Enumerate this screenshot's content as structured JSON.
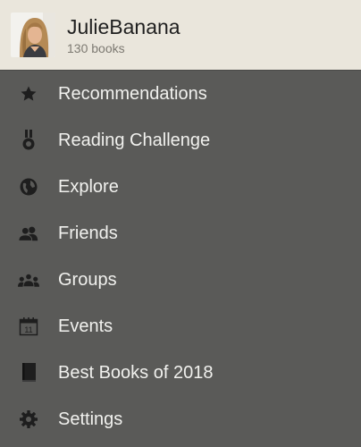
{
  "profile": {
    "username": "JulieBanana",
    "book_count": "130 books",
    "avatar_icon": "user-avatar-photo"
  },
  "menu": {
    "items": [
      {
        "label": "Recommendations",
        "icon": "star-icon"
      },
      {
        "label": "Reading Challenge",
        "icon": "medal-icon"
      },
      {
        "label": "Explore",
        "icon": "globe-icon"
      },
      {
        "label": "Friends",
        "icon": "friends-icon"
      },
      {
        "label": "Groups",
        "icon": "groups-icon"
      },
      {
        "label": "Events",
        "icon": "calendar-icon",
        "calendar_day": "11"
      },
      {
        "label": "Best Books of 2018",
        "icon": "book-icon"
      },
      {
        "label": "Settings",
        "icon": "gear-icon"
      }
    ]
  },
  "colors": {
    "header_bg": "#eae6dc",
    "menu_bg": "#5a5a58",
    "menu_text": "#f1f1ee",
    "icon_color": "#1e1e1e"
  }
}
